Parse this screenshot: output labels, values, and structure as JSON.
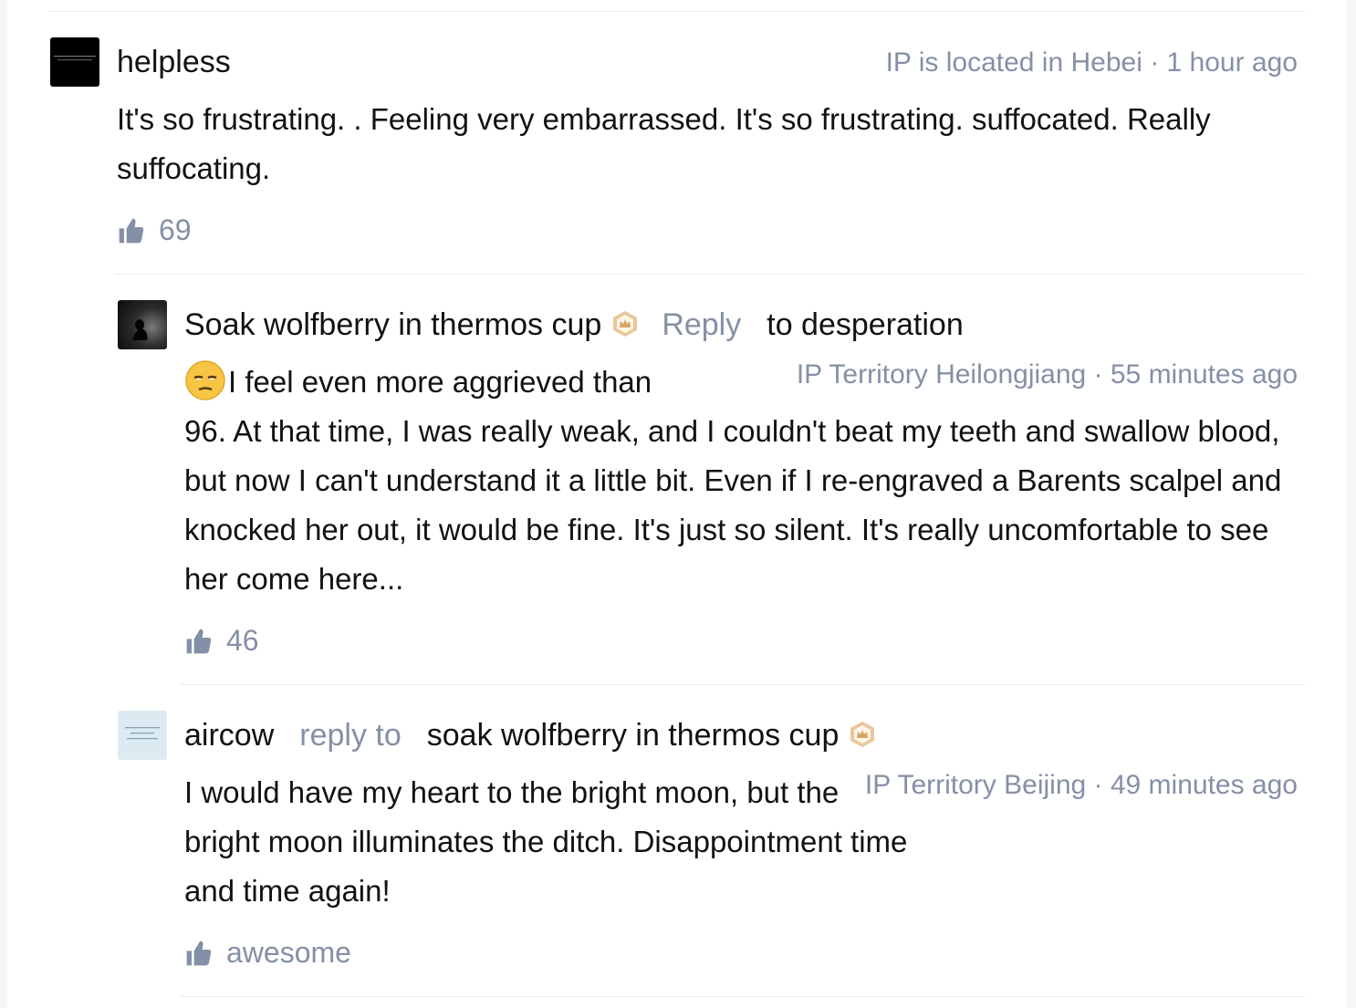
{
  "comments": [
    {
      "author": "helpless",
      "meta": "IP is located in Hebei · 1 hour ago",
      "text": "It's so frustrating. . Feeling very embarrassed. It's so frustrating. suffocated. Really suffocating.",
      "likes": "69"
    },
    {
      "author": "Soak wolfberry in thermos cup",
      "reply_word": "Reply",
      "reply_target": "to desperation",
      "meta": "IP Territory Heilongjiang · 55 minutes ago",
      "text_first": "I feel even more aggrieved than",
      "text_rest": "96. At that time, I was really weak, and I couldn't beat my teeth and swallow blood, but now I can't understand it a little bit. Even if I re-engraved a Barents scalpel and knocked her out, it would be fine. It's just so silent. It's really uncomfortable to see her come here...",
      "likes": "46"
    },
    {
      "author": "aircow",
      "reply_word": "reply to",
      "reply_target": "soak wolfberry in thermos cup",
      "meta": "IP Territory Beijing · 49 minutes ago",
      "text": "I would have my heart to the bright moon, but the bright moon illuminates the ditch. Disappointment time and time again!",
      "likes": "awesome"
    }
  ],
  "colors": {
    "muted": "#8590a6",
    "text": "#121212",
    "divider": "#ebebeb",
    "badge": "#d9a566"
  },
  "icons": [
    "thumbs-up-icon",
    "badge-icon",
    "sad-emoji"
  ]
}
